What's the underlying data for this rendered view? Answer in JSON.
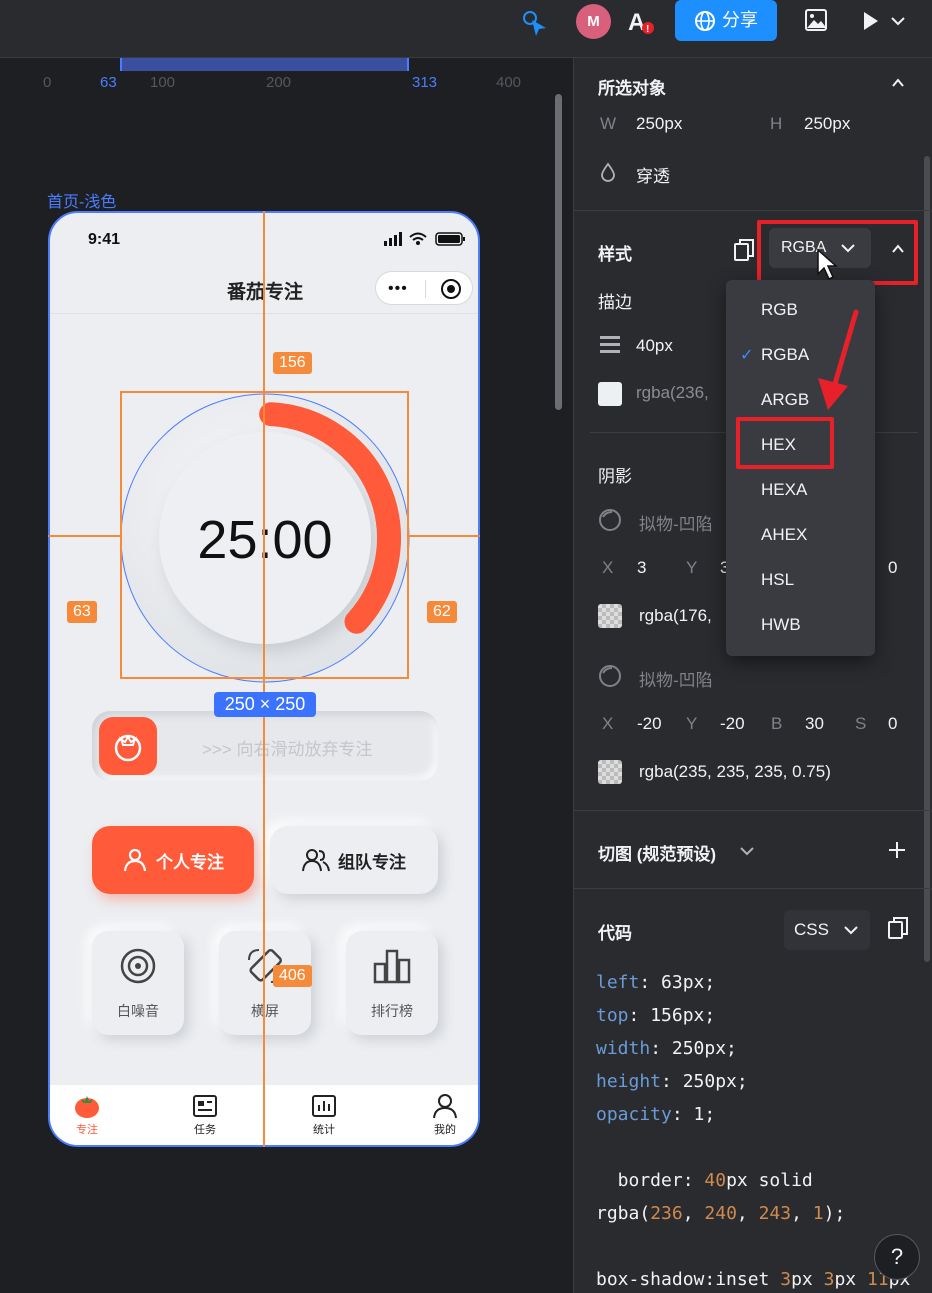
{
  "topbar": {
    "avatar_initial": "M",
    "share_label": "分享"
  },
  "canvas": {
    "ruler_ticks": [
      "0",
      "63",
      "100",
      "200",
      "313",
      "400"
    ],
    "frame_label": "首页-浅色",
    "phone": {
      "status_time": "9:41",
      "nav_title": "番茄专注",
      "timer": "25:00",
      "timer_progress": 0.36,
      "slide_hint": ">>> 向右滑动放弃专注",
      "btn_personal": "个人专注",
      "btn_team": "组队专注",
      "tiles": [
        "白噪音",
        "横屏",
        "排行榜"
      ],
      "tabs": [
        "专注",
        "任务",
        "统计",
        "我的"
      ]
    },
    "measure": {
      "top": "156",
      "left": "63",
      "right": "62",
      "bottom": "406",
      "size": "250 × 250"
    }
  },
  "panel": {
    "selected_title": "所选对象",
    "w_label": "W",
    "w_value": "250px",
    "h_label": "H",
    "h_value": "250px",
    "pass_through": "穿透",
    "style_title": "样式",
    "color_format": "RGBA",
    "stroke_title": "描边",
    "stroke_width": "40px",
    "stroke_color": "rgba(236,",
    "shadow_title": "阴影",
    "shadow1_name": "拟物-凹陷",
    "shadow1_x_label": "X",
    "shadow1_x": "3",
    "shadow1_y_label": "Y",
    "shadow1_y": "3",
    "shadow1_s": "0",
    "shadow1_color": "rgba(176,",
    "shadow2_name": "拟物-凹陷",
    "shadow2_x_label": "X",
    "shadow2_x": "-20",
    "shadow2_y_label": "Y",
    "shadow2_y": "-20",
    "shadow2_b_label": "B",
    "shadow2_b": "30",
    "shadow2_s_label": "S",
    "shadow2_s": "0",
    "shadow2_color": "rgba(235, 235, 235, 0.75)",
    "slice_title": "切图 (规范预设)",
    "code_title": "代码",
    "code_lang": "CSS",
    "dropdown_options": [
      "RGB",
      "RGBA",
      "ARGB",
      "HEX",
      "HEXA",
      "AHEX",
      "HSL",
      "HWB"
    ],
    "dropdown_selected": "RGBA",
    "help": "?"
  },
  "colors": {
    "accent": "#ff5a39",
    "blue": "#1e8fff",
    "highlight_red": "#e8202a",
    "measure_orange": "#f58a3a"
  }
}
